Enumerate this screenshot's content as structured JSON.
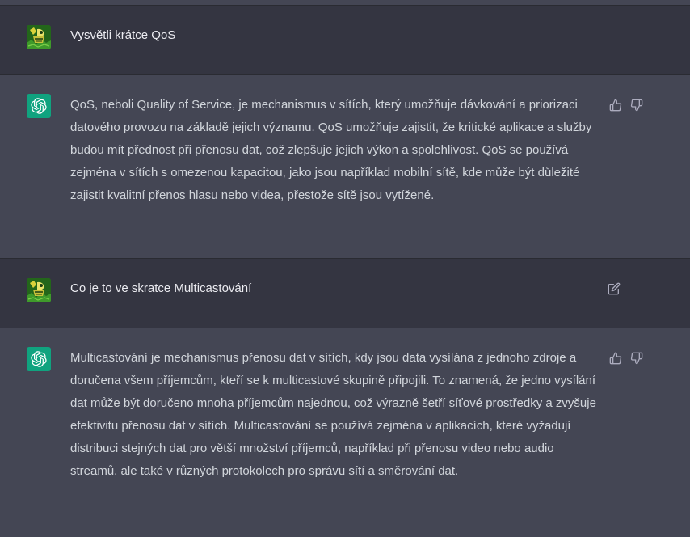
{
  "conversation": [
    {
      "role": "user",
      "text": "Vysvětli krátce QoS"
    },
    {
      "role": "assistant",
      "text": "QoS, neboli Quality of Service, je mechanismus v sítích, který umožňuje dávkování a priorizaci datového provozu na základě jejich významu. QoS umožňuje zajistit, že kritické aplikace a služby budou mít přednost při přenosu dat, což zlepšuje jejich výkon a spolehlivost. QoS se používá zejména v sítích s omezenou kapacitou, jako jsou například mobilní sítě, kde může být důležité zajistit kvalitní přenos hlasu nebo videa, přestože sítě jsou vytížené."
    },
    {
      "role": "user",
      "text": "Co je to ve skratce Multicastování"
    },
    {
      "role": "assistant",
      "text": "Multicastování je mechanismus přenosu dat v sítích, kdy jsou data vysílána z jednoho zdroje a doručena všem příjemcům, kteří se k multicastové skupině připojili. To znamená, že jedno vysílání dat může být doručeno mnoha příjemcům najednou, což výrazně šetří síťové prostředky a zvyšuje efektivitu přenosu dat v sítích. Multicastování se používá zejména v aplikacích, které vyžadují distribuci stejných dat pro větší množství příjemců, například při přenosu video nebo audio streamů, ale také v různých protokolech pro správu sítí a směrování dat."
    }
  ],
  "icons": {
    "user_avatar": "user-avatar-image",
    "assistant_avatar": "openai-logo-icon",
    "like": "thumbs-up-icon",
    "dislike": "thumbs-down-icon",
    "edit": "edit-icon"
  },
  "colors": {
    "user_row_bg": "#343541",
    "assistant_row_bg": "#444654",
    "gpt_avatar_bg": "#10a37f",
    "text": "#d1d5db",
    "icon": "#acacbe"
  }
}
